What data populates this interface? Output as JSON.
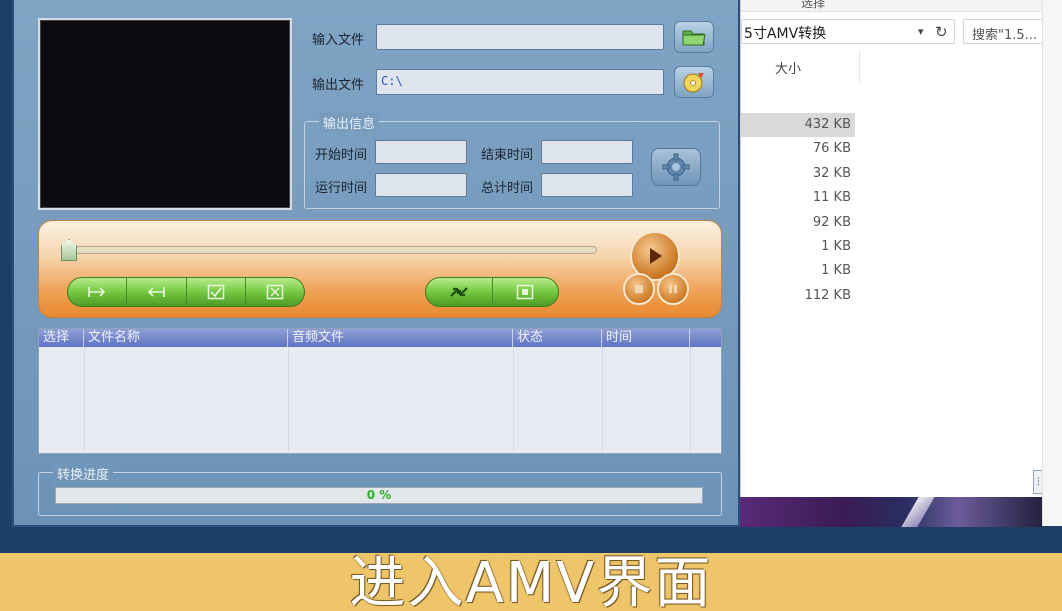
{
  "amv": {
    "input_label": "输入文件",
    "input_value": "",
    "output_label": "输出文件",
    "output_value": "C:\\",
    "output_info": {
      "title": "输出信息",
      "start_label": "开始时间",
      "end_label": "结束时间",
      "run_label": "运行时间",
      "total_label": "总计时间"
    },
    "list_columns": [
      "选择",
      "文件名称",
      "音频文件",
      "状态",
      "时间"
    ],
    "progress": {
      "title": "转换进度",
      "value": 0,
      "text": "0 %"
    }
  },
  "explorer": {
    "ribbon_label": "选择",
    "address": "5寸AMV转换",
    "search_placeholder": "搜索\"1.5...",
    "column_size": "大小",
    "sizes": [
      "432 KB",
      "76 KB",
      "32 KB",
      "11 KB",
      "92 KB",
      "1 KB",
      "1 KB",
      "112 KB"
    ],
    "scroll_glyph": "⋮"
  },
  "banner": {
    "caption": "进入AMV界面"
  },
  "colors": {
    "accent_orange": "#ee9f52",
    "pill_green": "#6fc33c",
    "progress_green": "#2bb324",
    "banner": "#efc56a"
  }
}
